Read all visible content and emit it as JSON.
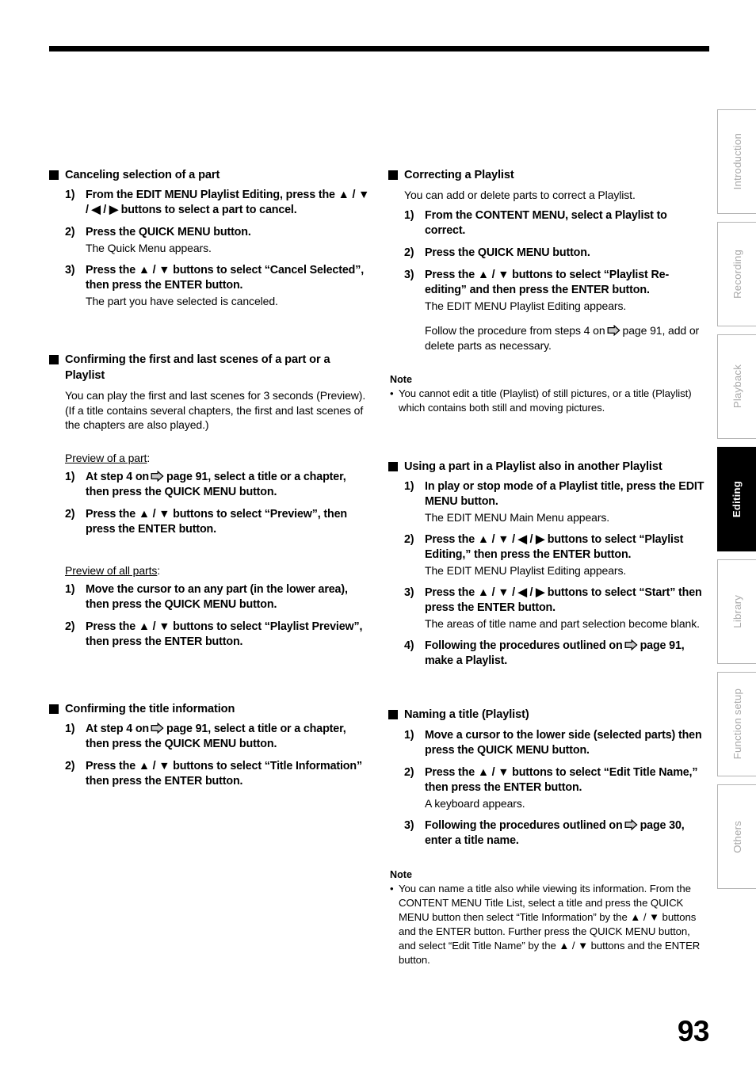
{
  "document": {
    "page_number": "93",
    "header_rule": true
  },
  "icons": {
    "arrow_page_ref": "right-arrow-icon",
    "section_bullet": "filled-square-icon",
    "note_bullet": "•",
    "up": "▲",
    "down": "▼",
    "left": "◀",
    "right": "▶"
  },
  "colors": {
    "text": "#000000",
    "arrow_fill": "#c8c8c8",
    "arrow_stroke": "#000000",
    "tab_inactive_text": "#a8a8a8",
    "tab_inactive_border": "#b4b4b4",
    "tab_active_bg": "#000000",
    "tab_active_text": "#ffffff"
  },
  "left_column": {
    "sections": [
      {
        "heading": "Canceling selection of a part",
        "steps": [
          {
            "num": "1)",
            "text": "From the EDIT MENU Playlist Editing, press the ▲ / ▼ / ◀ / ▶ buttons to select a part to cancel."
          },
          {
            "num": "2)",
            "text": "Press the QUICK MENU button.",
            "result": "The Quick Menu appears."
          },
          {
            "num": "3)",
            "text": "Press the ▲ / ▼ buttons to select “Cancel Selected”, then press the ENTER button.",
            "result": "The part you have selected is canceled."
          }
        ]
      },
      {
        "heading": "Confirming the first and last scenes of a part or a Playlist",
        "lead": "You can play the first and last scenes for 3 seconds (Preview). (If a title contains several chapters, the first and last scenes of the chapters are also played.)",
        "sub_label_1": "Preview of a part",
        "sub_label_1_suffix": ":",
        "steps_1": [
          {
            "num": "1)",
            "text_before": "At step 4 on",
            "text_after": "page 91, select a title or a chapter, then press the QUICK MENU button."
          },
          {
            "num": "2)",
            "text": "Press the ▲ / ▼ buttons to select “Preview”, then press the ENTER button."
          }
        ],
        "sub_label_2": "Preview of all parts",
        "sub_label_2_suffix": ":",
        "steps_2": [
          {
            "num": "1)",
            "text": "Move the cursor to an any part (in the lower area), then press the QUICK MENU button."
          },
          {
            "num": "2)",
            "text": "Press the ▲ / ▼ buttons to select “Playlist Preview”, then press the ENTER button."
          }
        ]
      },
      {
        "heading": "Confirming the title information",
        "steps": [
          {
            "num": "1)",
            "text_before": "At step 4 on",
            "text_after": "page 91, select a title or a chapter, then press the QUICK MENU button."
          },
          {
            "num": "2)",
            "text": "Press the ▲ / ▼ buttons to select “Title Information” then press the ENTER button."
          }
        ]
      }
    ]
  },
  "right_column": {
    "sections": [
      {
        "heading": "Correcting a Playlist",
        "lead": "You can add or delete parts to correct a Playlist.",
        "steps": [
          {
            "num": "1)",
            "text": "From the CONTENT MENU, select a Playlist to correct."
          },
          {
            "num": "2)",
            "text": "Press the QUICK MENU button."
          },
          {
            "num": "3)",
            "text": "Press the ▲ / ▼ buttons to select “Playlist Re-editing” and then press the ENTER button.",
            "result": "The EDIT MENU Playlist Editing appears.",
            "result2_before": "Follow the procedure from steps 4 on",
            "result2_after": "page 91, add or delete parts as necessary."
          }
        ],
        "note": {
          "title": "Note",
          "items": [
            "You cannot edit a title (Playlist) of still pictures, or a title (Playlist) which contains both still and moving pictures."
          ]
        }
      },
      {
        "heading": "Using a part in a Playlist also in another Playlist",
        "steps": [
          {
            "num": "1)",
            "text": "In play or stop mode of a Playlist title, press the EDIT MENU button.",
            "result": "The EDIT MENU Main Menu appears."
          },
          {
            "num": "2)",
            "text": "Press the ▲ / ▼ / ◀ / ▶ buttons to select “Playlist Editing,” then press the ENTER button.",
            "result": "The EDIT MENU Playlist Editing appears."
          },
          {
            "num": "3)",
            "text": "Press the ▲ / ▼ / ◀ / ▶ buttons to select “Start” then press the ENTER button.",
            "result": "The areas of title name and part selection become blank."
          },
          {
            "num": "4)",
            "text_before": "Following the procedures outlined on",
            "text_after": "page 91, make a Playlist."
          }
        ]
      },
      {
        "heading": "Naming a title (Playlist)",
        "steps": [
          {
            "num": "1)",
            "text": "Move a cursor to the lower side (selected parts) then press the QUICK MENU button."
          },
          {
            "num": "2)",
            "text": "Press the ▲ / ▼ buttons to select “Edit Title Name,” then press the ENTER button.",
            "result": "A keyboard appears."
          },
          {
            "num": "3)",
            "text_before": "Following the procedures outlined on",
            "text_after": "page 30, enter a title name."
          }
        ],
        "note": {
          "title": "Note",
          "items": [
            "You can name a title also while viewing its information. From the CONTENT MENU Title List, select a title and press the QUICK MENU button then select “Title Information” by the ▲ / ▼ buttons and the ENTER button. Further press the QUICK MENU button, and select “Edit Title Name” by the ▲ / ▼ buttons and the ENTER button."
          ]
        }
      }
    ]
  },
  "tabs": [
    {
      "label": "Introduction",
      "active": false
    },
    {
      "label": "Recording",
      "active": false
    },
    {
      "label": "Playback",
      "active": false
    },
    {
      "label": "Editing",
      "active": true
    },
    {
      "label": "Library",
      "active": false
    },
    {
      "label": "Function setup",
      "active": false
    },
    {
      "label": "Others",
      "active": false
    }
  ]
}
